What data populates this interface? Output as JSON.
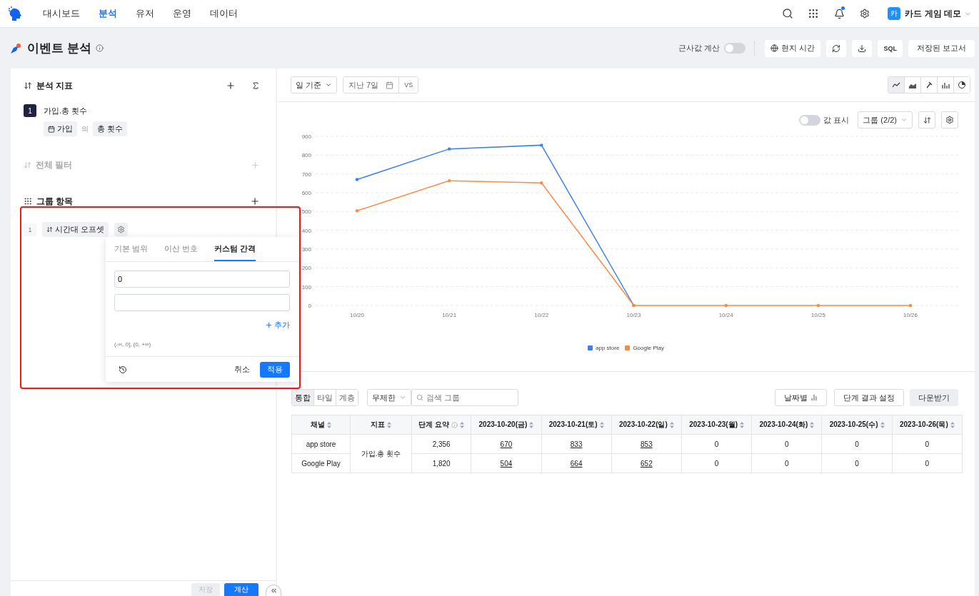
{
  "nav": {
    "items": [
      {
        "label": "대시보드",
        "selected": false
      },
      {
        "label": "분석",
        "selected": true
      },
      {
        "label": "유저",
        "selected": false
      },
      {
        "label": "운영",
        "selected": false
      },
      {
        "label": "데이터",
        "selected": false
      }
    ],
    "has_notification": true,
    "workspace_avatar": "카",
    "workspace": "카드 게임 데모"
  },
  "page": {
    "title": "이벤트 분석",
    "approx": {
      "label": "근사값 계산",
      "on": false
    },
    "buttons": [
      "현지 시간",
      "저장된 보고서"
    ],
    "sql": "SQL"
  },
  "left": {
    "metrics_title": "분석 지표",
    "metrics": [
      {
        "index": "1",
        "name": "가입.총 횟수",
        "event": "가입",
        "of": "의",
        "measure": "총 횟수"
      }
    ],
    "filter_title": "전체 필터",
    "group_title": "그룹 항목",
    "groups": [
      {
        "index": "1",
        "name": "시간대 오프셋"
      }
    ],
    "popover": {
      "tabs": [
        {
          "label": "기본 범위",
          "selected": false
        },
        {
          "label": "이산 번호",
          "selected": false
        },
        {
          "label": "커스텀 간격",
          "selected": true
        }
      ],
      "inputs": [
        {
          "kind": "filled",
          "value": "0"
        },
        {
          "kind": "empty"
        }
      ],
      "add": "추가",
      "range": "(-∞, 0], (0, +∞)",
      "cancel": "취소",
      "apply": "적용"
    },
    "footer": {
      "save": {
        "label": "저장",
        "disabled": true
      },
      "run": "계산"
    }
  },
  "right": {
    "granularity": "일 기준",
    "date_range": "지난 7일",
    "compare": "VS",
    "chart_types": [
      {
        "kind": "line",
        "selected": true
      },
      {
        "kind": "area",
        "selected": false
      },
      {
        "kind": "pin",
        "selected": false
      },
      {
        "kind": "bar",
        "selected": false
      },
      {
        "kind": "pie",
        "selected": false
      }
    ],
    "show_values": {
      "label": "값 표시",
      "on": false
    },
    "group_select": "그룹 (2/2)",
    "chart_data": {
      "type": "line",
      "grid": true,
      "categories": [
        "10/20",
        "10/21",
        "10/22",
        "10/23",
        "10/24",
        "10/25",
        "10/26"
      ],
      "yticks": [
        0,
        100,
        200,
        300,
        400,
        500,
        600,
        700,
        800,
        900
      ],
      "ylim": [
        0,
        900
      ],
      "series": [
        {
          "name": "app store",
          "color": "#3b82f0",
          "values": [
            670,
            833,
            853,
            0,
            null,
            null,
            null
          ]
        },
        {
          "name": "Google Play",
          "color": "#f98b44",
          "values": [
            504,
            664,
            652,
            0,
            0,
            0,
            0
          ]
        }
      ]
    },
    "views": [
      {
        "label": "통합",
        "selected": true
      },
      {
        "label": "타일",
        "selected": false
      },
      {
        "label": "계층",
        "selected": false
      }
    ],
    "limit": "무제한",
    "search": {
      "placeholder": "검색 그룹"
    },
    "by_date": "날짜별",
    "step_settings": "단계 결과 설정",
    "download": "다운받기",
    "table": {
      "columns": [
        {
          "label": "채널",
          "info": false
        },
        {
          "label": "지표",
          "info": false
        },
        {
          "label": "단계 요약",
          "info": true
        },
        {
          "label": "2023-10-20(금)",
          "info": false
        },
        {
          "label": "2023-10-21(토)",
          "info": false
        },
        {
          "label": "2023-10-22(일)",
          "info": false
        },
        {
          "label": "2023-10-23(월)",
          "info": false
        },
        {
          "label": "2023-10-24(화)",
          "info": false
        },
        {
          "label": "2023-10-25(수)",
          "info": false
        },
        {
          "label": "2023-10-26(목)",
          "info": false
        }
      ],
      "metric": "가입.총 횟수",
      "rows": [
        {
          "channel": "app store",
          "summary": "2,356",
          "values": [
            {
              "text": "670",
              "link": true
            },
            {
              "text": "833",
              "link": true
            },
            {
              "text": "853",
              "link": true
            },
            {
              "text": "0",
              "link": false
            },
            {
              "text": "0",
              "link": false
            },
            {
              "text": "0",
              "link": false
            },
            {
              "text": "0",
              "link": false
            }
          ]
        },
        {
          "channel": "Google Play",
          "summary": "1,820",
          "values": [
            {
              "text": "504",
              "link": true
            },
            {
              "text": "664",
              "link": true
            },
            {
              "text": "652",
              "link": true
            },
            {
              "text": "0",
              "link": false
            },
            {
              "text": "0",
              "link": false
            },
            {
              "text": "0",
              "link": false
            },
            {
              "text": "0",
              "link": false
            }
          ]
        }
      ]
    }
  }
}
